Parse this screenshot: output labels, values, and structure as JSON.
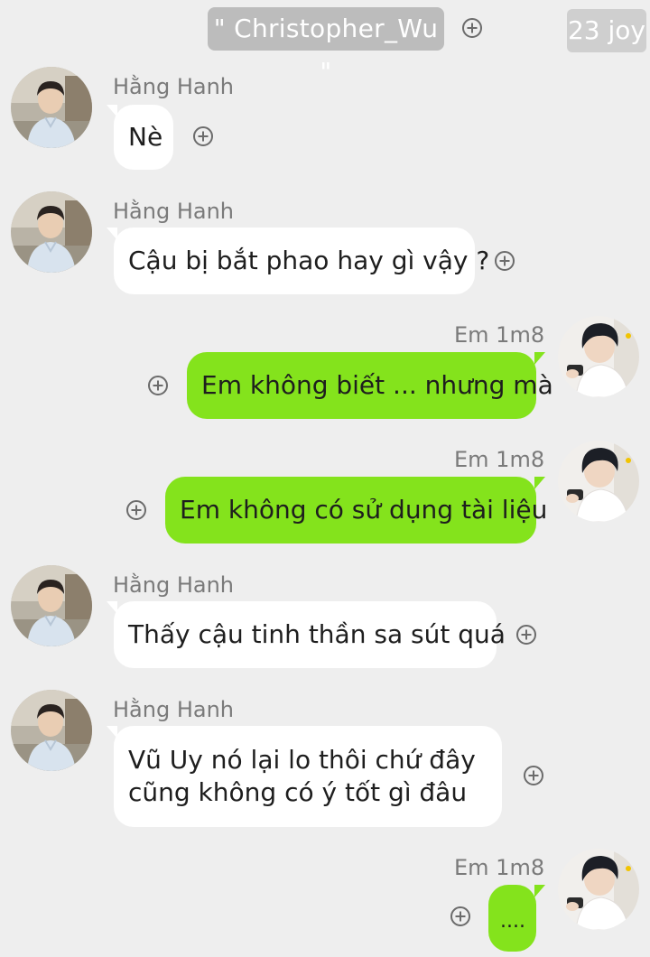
{
  "header": {
    "title": "\" Christopher_Wu \"",
    "watermark": "23 joy"
  },
  "colors": {
    "background": "#eeeeee",
    "incoming_bubble": "#ffffff",
    "outgoing_bubble": "#84e31c",
    "name_text": "#7a7a7a"
  },
  "messages": [
    {
      "sender": "Hằng Hanh",
      "direction": "incoming",
      "text": "Nè"
    },
    {
      "sender": "Hằng Hanh",
      "direction": "incoming",
      "text": "Cậu bị bắt phao hay gì vậy ?"
    },
    {
      "sender": "Em 1m8",
      "direction": "outgoing",
      "text": "Em không biết ... nhưng mà"
    },
    {
      "sender": "Em 1m8",
      "direction": "outgoing",
      "text": "Em không có sử dụng tài liệu"
    },
    {
      "sender": "Hằng Hanh",
      "direction": "incoming",
      "text": "Thấy cậu tinh thần sa sút quá"
    },
    {
      "sender": "Hằng Hanh",
      "direction": "incoming",
      "text_line1": "Vũ Uy nó lại lo thôi chứ đây",
      "text_line2": "cũng không có ý tốt gì đâu"
    },
    {
      "sender": "Em 1m8",
      "direction": "outgoing",
      "text": "...."
    }
  ],
  "icons": {
    "add": "plus-circle-icon",
    "avatar_incoming": "avatar-hang-hanh",
    "avatar_outgoing": "avatar-em-1m8"
  }
}
